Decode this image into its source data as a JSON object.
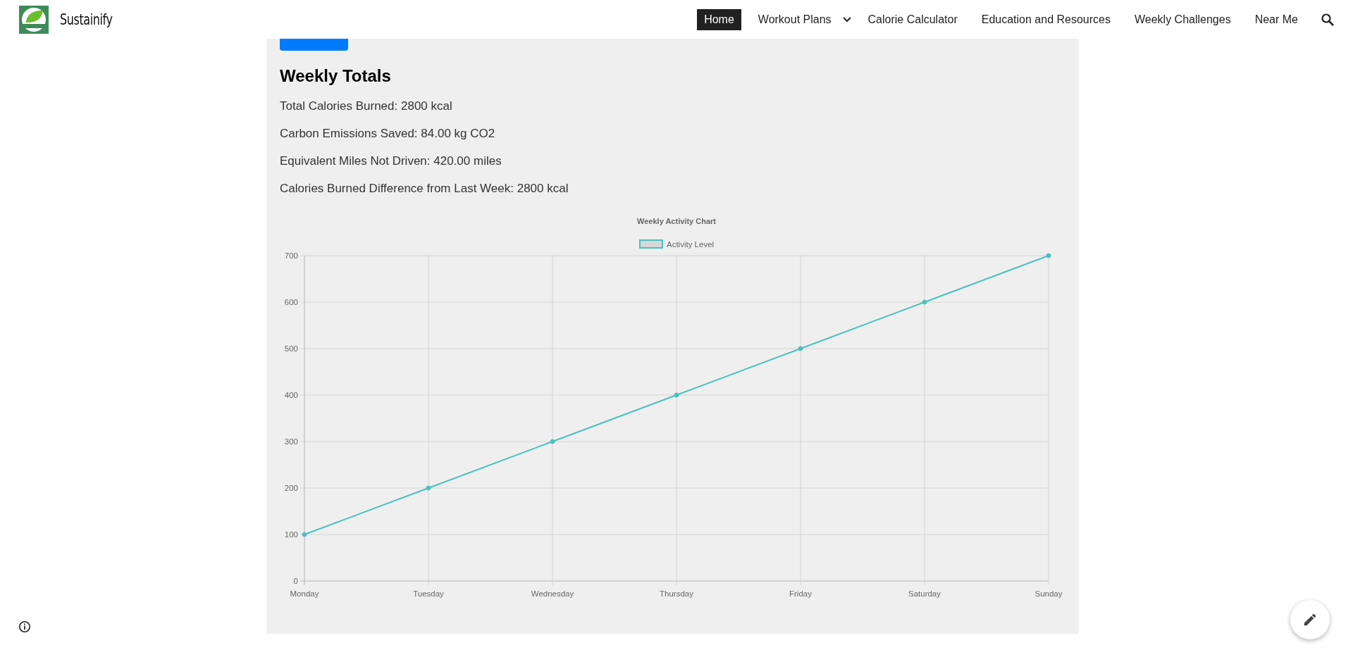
{
  "header": {
    "site_name": "Sustainify",
    "nav": [
      {
        "label": "Home",
        "selected": true,
        "has_dropdown": false
      },
      {
        "label": "Workout Plans",
        "selected": false,
        "has_dropdown": true
      },
      {
        "label": "Calorie Calculator",
        "selected": false,
        "has_dropdown": false
      },
      {
        "label": "Education and Resources",
        "selected": false,
        "has_dropdown": false
      },
      {
        "label": "Weekly Challenges",
        "selected": false,
        "has_dropdown": false
      },
      {
        "label": "Near Me",
        "selected": false,
        "has_dropdown": false
      }
    ]
  },
  "content": {
    "heading": "Weekly Totals",
    "stats": [
      "Total Calories Burned: 2800 kcal",
      "Carbon Emissions Saved: 84.00 kg CO2",
      "Equivalent Miles Not Driven: 420.00 miles",
      "Calories Burned Difference from Last Week: 2800 kcal"
    ],
    "chart_data": {
      "type": "line",
      "title": "Weekly Activity Chart",
      "categories": [
        "Monday",
        "Tuesday",
        "Wednesday",
        "Thursday",
        "Friday",
        "Saturday",
        "Sunday"
      ],
      "grid": true,
      "series": [
        {
          "name": "Activity Level",
          "color": "#4bc0c0",
          "marker": true,
          "values": [
            100,
            200,
            300,
            400,
            500,
            600,
            700
          ]
        }
      ],
      "ylim": [
        0,
        700
      ],
      "yticks": [
        0,
        100,
        200,
        300,
        400,
        500,
        600,
        700
      ]
    }
  }
}
